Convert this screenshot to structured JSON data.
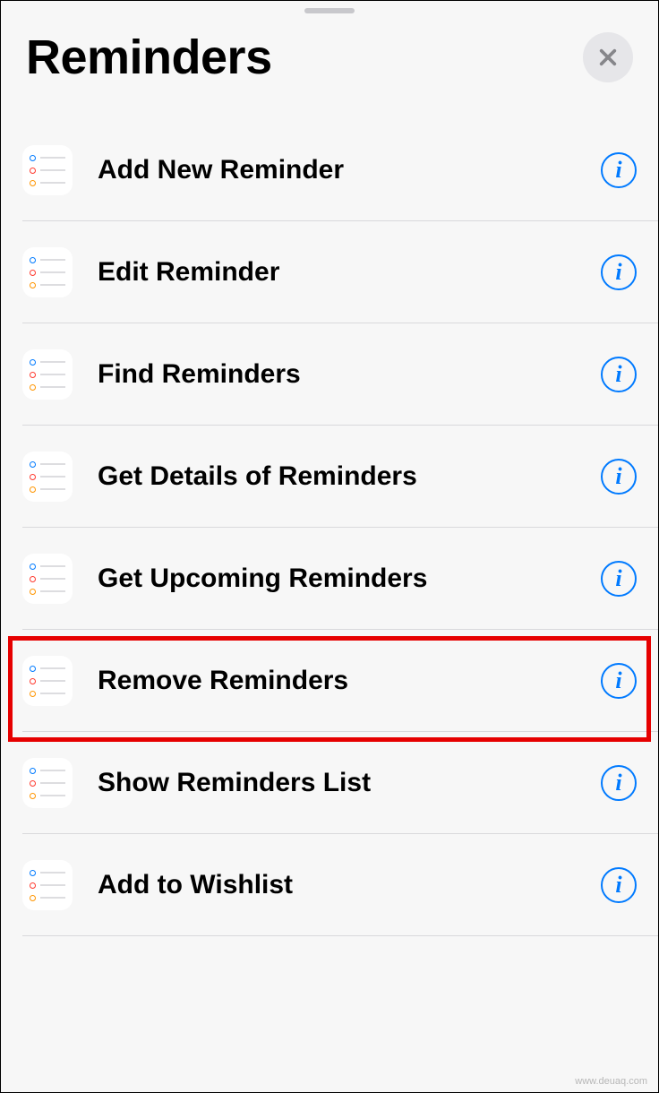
{
  "header": {
    "title": "Reminders"
  },
  "actions": [
    {
      "label": "Add New Reminder"
    },
    {
      "label": "Edit Reminder"
    },
    {
      "label": "Find Reminders"
    },
    {
      "label": "Get Details of Reminders"
    },
    {
      "label": "Get Upcoming Reminders"
    },
    {
      "label": "Remove Reminders"
    },
    {
      "label": "Show Reminders List"
    },
    {
      "label": "Add to Wishlist"
    }
  ],
  "highlighted_index": 5,
  "watermark": "www.deuaq.com"
}
